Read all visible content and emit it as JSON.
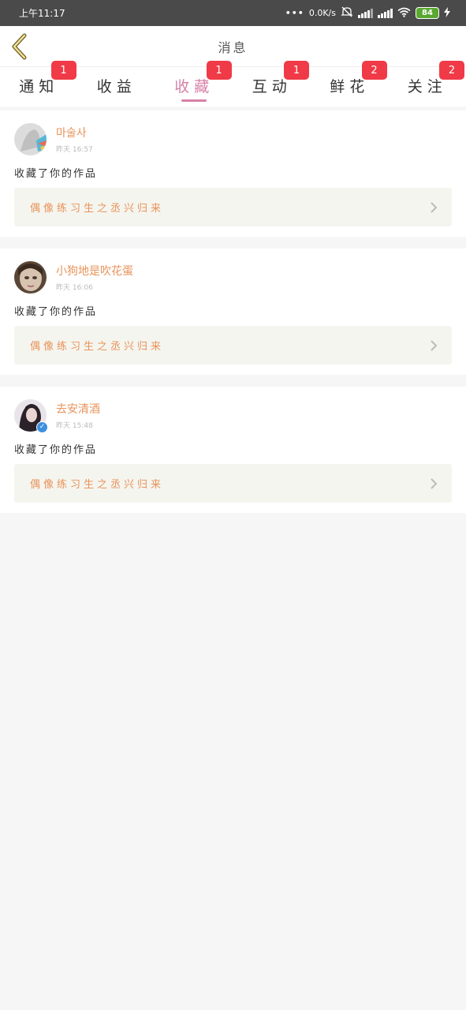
{
  "status_bar": {
    "time": "上午11:17",
    "network_speed": "0.0K/s",
    "battery": "84",
    "icons": [
      "dots-icon",
      "mute-icon",
      "signal-icon",
      "hd-signal-icon",
      "wifi-icon",
      "battery-icon",
      "charging-icon"
    ]
  },
  "header": {
    "title": "消息",
    "back_icon": "chevron-left-icon"
  },
  "tabs": [
    {
      "label": "通知",
      "badge": "1",
      "active": false
    },
    {
      "label": "收益",
      "badge": "",
      "active": false
    },
    {
      "label": "收藏",
      "badge": "1",
      "active": true
    },
    {
      "label": "互动",
      "badge": "1",
      "active": false
    },
    {
      "label": "鲜花",
      "badge": "2",
      "active": false
    },
    {
      "label": "关注",
      "badge": "2",
      "active": false
    }
  ],
  "colors": {
    "accent": "#d680a8",
    "badge": "#f03a47",
    "username": "#e8935a",
    "link_bg": "#f5f5ef"
  },
  "messages": [
    {
      "user": "마술사",
      "time": "昨天 16:57",
      "action": "收藏了你的作品",
      "work": "偶像练习生之丞兴归来",
      "verified": false
    },
    {
      "user": "小狗地是吹花蛋",
      "time": "昨天 16:06",
      "action": "收藏了你的作品",
      "work": "偶像练习生之丞兴归来",
      "verified": false
    },
    {
      "user": "去安清酒",
      "time": "昨天 15:48",
      "action": "收藏了你的作品",
      "work": "偶像练习生之丞兴归来",
      "verified": true
    }
  ]
}
